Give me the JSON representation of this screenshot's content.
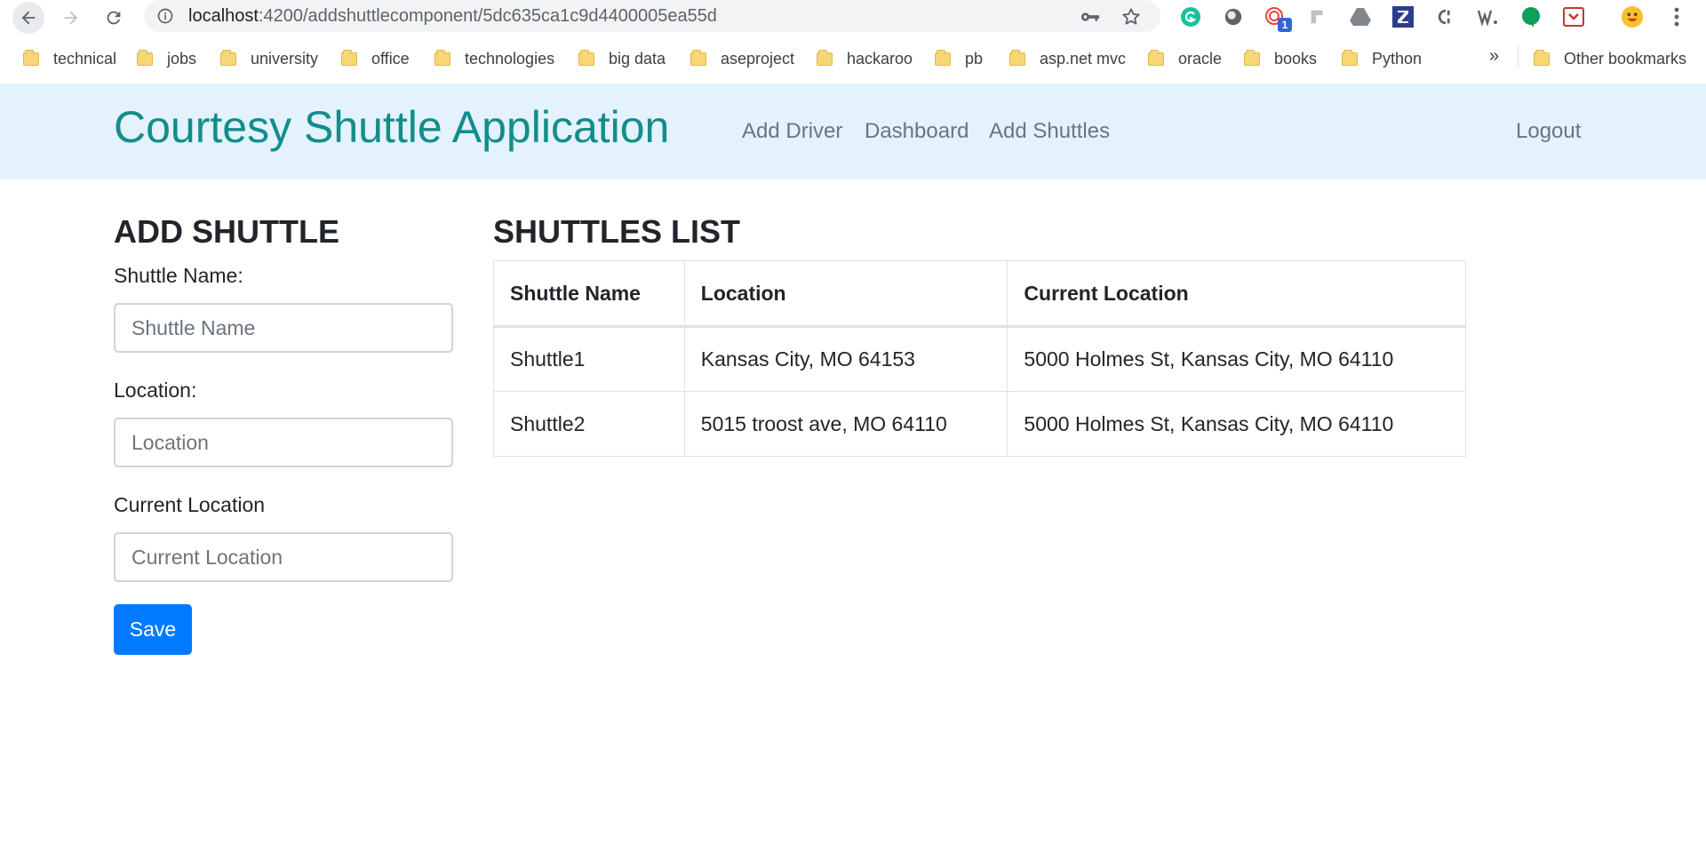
{
  "browser": {
    "url_host": "localhost",
    "url_path": ":4200/addshuttlecomponent/5dc635ca1c9d4400005ea55d",
    "extension_badge": "1",
    "bookmarks": [
      "technical",
      "jobs",
      "university",
      "office",
      "technologies",
      "big data",
      "aseproject",
      "hackaroo",
      "pb",
      "asp.net mvc",
      "oracle",
      "books",
      "Python"
    ],
    "more_bookmarks": "»",
    "other_bookmarks": "Other bookmarks"
  },
  "navbar": {
    "brand": "Courtesy Shuttle Application",
    "links": [
      "Add Driver",
      "Dashboard",
      "Add Shuttles"
    ],
    "logout": "Logout",
    "bg_color": "#e3f2fd",
    "brand_color": "#138d8a"
  },
  "form": {
    "title": "ADD SHUTTLE",
    "fields": [
      {
        "label": "Shuttle Name:",
        "placeholder": "Shuttle Name",
        "value": ""
      },
      {
        "label": "Location:",
        "placeholder": "Location",
        "value": ""
      },
      {
        "label": "Current Location",
        "placeholder": "Current Location",
        "value": ""
      }
    ],
    "save_label": "Save",
    "button_color": "#007bff"
  },
  "list": {
    "title": "SHUTTLES LIST",
    "columns": [
      "Shuttle Name",
      "Location",
      "Current Location"
    ],
    "rows": [
      [
        "Shuttle1",
        "Kansas City, MO 64153",
        "5000 Holmes St, Kansas City, MO 64110"
      ],
      [
        "Shuttle2",
        "5015 troost ave, MO 64110",
        "5000 Holmes St, Kansas City, MO 64110"
      ]
    ]
  }
}
